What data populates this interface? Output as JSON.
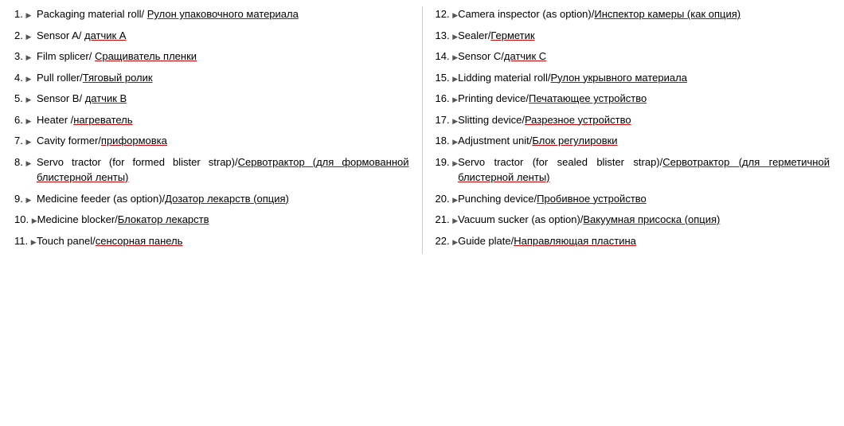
{
  "items": {
    "left": [
      {
        "num": "1.",
        "en": "Packaging material roll/ ",
        "ru": "Рулон упаковочного материала"
      },
      {
        "num": "2.",
        "en": "Sensor A/ ",
        "ru": "датчик А"
      },
      {
        "num": "3.",
        "en": "Film splicer/ ",
        "ru": "Сращиватель пленки"
      },
      {
        "num": "4.",
        "en": "Pull roller/",
        "ru": "Тяговый ролик"
      },
      {
        "num": "5.",
        "en": "Sensor B/ ",
        "ru": "датчик В"
      },
      {
        "num": "6.",
        "en": "Heater /",
        "ru": "нагреватель"
      },
      {
        "num": "7.",
        "en": "Cavity former/",
        "ru": "приформовка"
      },
      {
        "num": "8.",
        "en": "Servo      tractor      (for      formed      blister strap)/",
        "ru": "Сервотрактор      (для      формованной блистерной ленты)"
      },
      {
        "num": "9.",
        "en": "Medicine   feeder   (as   option)/",
        "ru": "Дозатор лекарств (опция)"
      },
      {
        "num": "10.",
        "en": "Medicine blocker/",
        "ru": "Блокатор лекарств"
      },
      {
        "num": "11.",
        "en": "Touch panel/",
        "ru": "сенсорная панель"
      }
    ],
    "right": [
      {
        "num": "12.",
        "en": "Camera   inspector   (as   option)/",
        "ru": "Инспектор камеры (как опция)"
      },
      {
        "num": "13.",
        "en": "Sealer/",
        "ru": "Герметик"
      },
      {
        "num": "14.",
        "en": "Sensor C/",
        "ru": "датчик С"
      },
      {
        "num": "15.",
        "en": "Lidding   material   roll/",
        "ru": "Рулон   укрывного материала"
      },
      {
        "num": "16.",
        "en": "Printing device/",
        "ru": "Печатающее устройство"
      },
      {
        "num": "17.",
        "en": "Slitting device/",
        "ru": "Разрезное устройство"
      },
      {
        "num": "18.",
        "en": "Adjustment unit/",
        "ru": "Блок регулировки"
      },
      {
        "num": "19.",
        "en": "Servo      tractor      (for      sealed      blister strap)/",
        "ru": "Сервотрактор      (для      герметичной блистерной ленты)"
      },
      {
        "num": "20.",
        "en": "Punching device/",
        "ru": "Пробивное устройство"
      },
      {
        "num": "21.",
        "en": "Vacuum   sucker   (as   option)/",
        "ru": "Вакуумная присоска (опция)"
      },
      {
        "num": "22.",
        "en": "Guide plate/",
        "ru": "Направляющая пластина"
      }
    ]
  }
}
